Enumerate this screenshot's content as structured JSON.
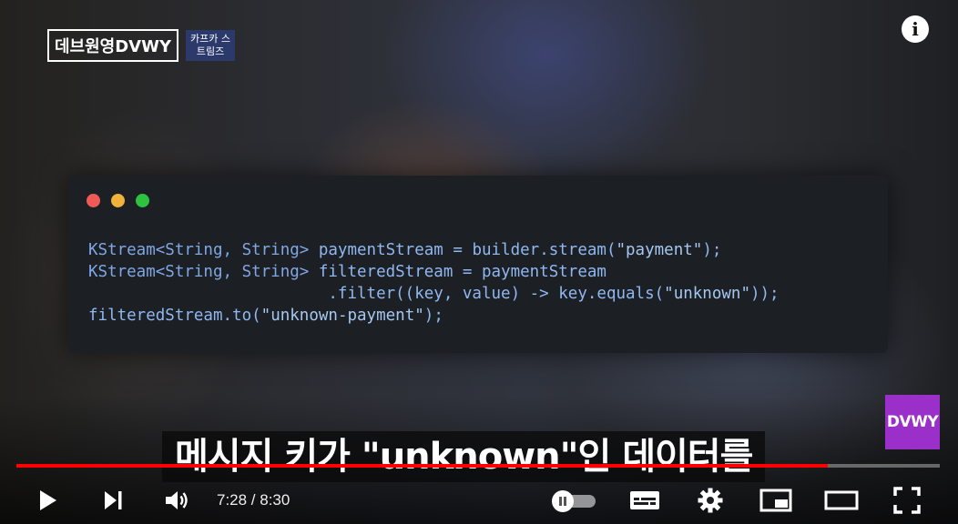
{
  "overlay": {
    "channel_name": "데브원영DVWY",
    "channel_tag": "카프카 스트림즈",
    "info_symbol": "i",
    "brand_badge": "DVWY"
  },
  "code": {
    "lines": [
      [
        {
          "t": "KStream<String, String>",
          "c": "type"
        },
        {
          "t": " paymentStream = builder.stream(",
          "c": "plain"
        },
        {
          "t": "\"payment\"",
          "c": "str"
        },
        {
          "t": ");",
          "c": "plain"
        }
      ],
      [
        {
          "t": "KStream<String, String>",
          "c": "type"
        },
        {
          "t": " filteredStream = paymentStream",
          "c": "plain"
        }
      ],
      [
        {
          "t": "                         .filter((key, value) -> key.equals(",
          "c": "plain"
        },
        {
          "t": "\"unknown\"",
          "c": "str"
        },
        {
          "t": "));",
          "c": "plain"
        }
      ],
      [
        {
          "t": "filteredStream.to(",
          "c": "plain"
        },
        {
          "t": "\"unknown-payment\"",
          "c": "str"
        },
        {
          "t": ");",
          "c": "plain"
        }
      ]
    ]
  },
  "subtitle": {
    "text": "메시지 키가 \"unknown\"인 데이터를"
  },
  "player": {
    "current_time": "7:28",
    "duration": "8:30",
    "time_text": "7:28 / 8:30",
    "progress_fraction": 0.879,
    "autoplay_on": false,
    "colors": {
      "progress": "#ff0000",
      "brand": "#9b2fc9"
    },
    "icons": {
      "play": "play-icon",
      "next": "skip-next-icon",
      "volume": "volume-icon",
      "autoplay": "autoplay-toggle",
      "subtitles": "subtitles-icon",
      "settings": "gear-icon",
      "miniplayer": "miniplayer-icon",
      "theater": "theater-mode-icon",
      "fullscreen": "fullscreen-icon"
    }
  }
}
